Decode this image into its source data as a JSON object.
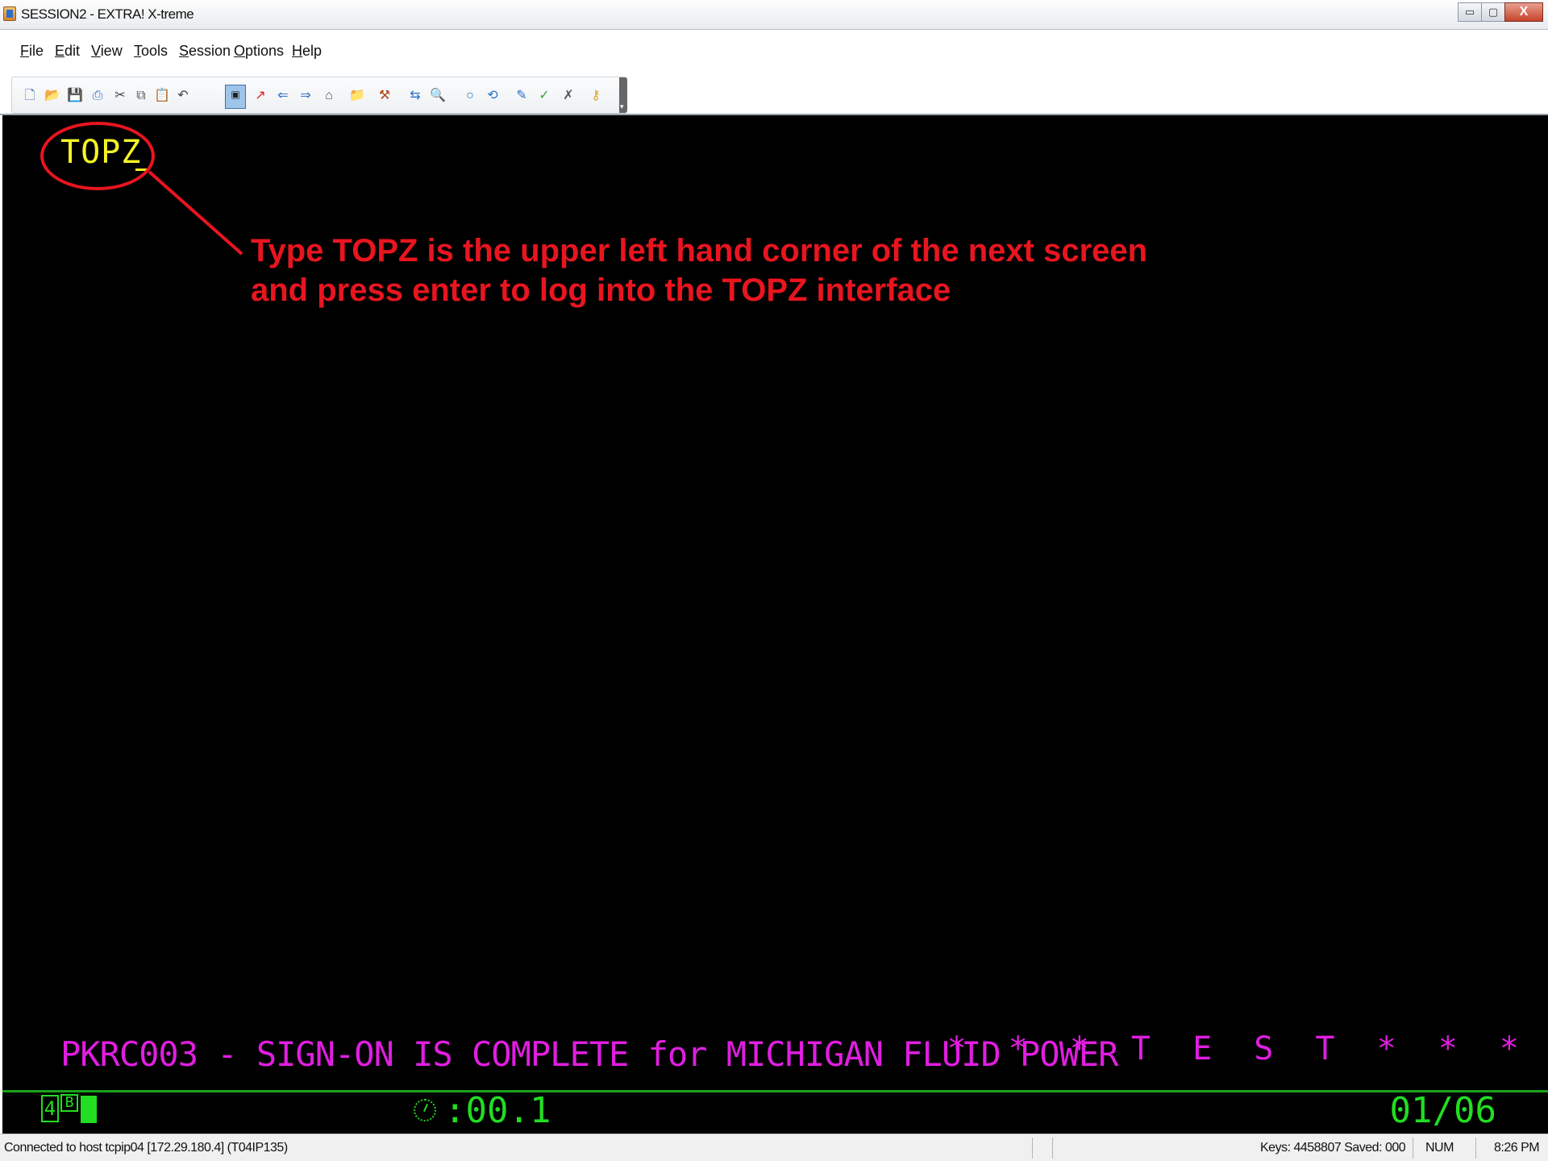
{
  "window": {
    "title": "SESSION2 - EXTRA! X-treme",
    "controls": {
      "minimize": "▭",
      "maximize": "▢",
      "close": "X"
    }
  },
  "menu": {
    "items": [
      {
        "label": "File",
        "key": "F",
        "rest": "ile"
      },
      {
        "label": "Edit",
        "key": "E",
        "rest": "dit"
      },
      {
        "label": "View",
        "key": "V",
        "rest": "iew"
      },
      {
        "label": "Tools",
        "key": "T",
        "rest": "ools"
      },
      {
        "label": "Session",
        "key": "S",
        "rest": "ession"
      },
      {
        "label": "Options",
        "key": "O",
        "rest": "ptions"
      },
      {
        "label": "Help",
        "key": "H",
        "rest": "elp"
      }
    ]
  },
  "toolbar": {
    "icons": [
      "new-icon",
      "open-icon",
      "save-icon",
      "print-icon",
      "cut-icon",
      "copy-icon",
      "paste-icon",
      "undo-icon",
      "display-toggle-icon",
      "connect-icon",
      "back-icon",
      "forward-icon",
      "home-icon",
      "folder-icon",
      "macro-icon",
      "file-transfer-icon",
      "find-icon",
      "circle-icon",
      "record-icon",
      "edit-macro-icon",
      "run-macro-icon",
      "stop-macro-icon",
      "help-key-icon"
    ]
  },
  "terminal": {
    "input_text": "TOPZ",
    "annotation": {
      "line1": "Type TOPZ is the upper left hand corner of the next screen",
      "line2": "and press enter to log into the TOPZ interface",
      "color": "#e8151f"
    },
    "message": "PKRC003 - SIGN-ON IS COMPLETE for MICHIGAN FLUID POWER",
    "test_banner": "* * * T E S T * * *",
    "oia": {
      "session_number": "4",
      "session_type": "B",
      "response_time": ":00.1",
      "cursor_position": "01/06"
    },
    "colors": {
      "background": "#000000",
      "input": "#f5f526",
      "message": "#e01ee0",
      "oia": "#22dd22"
    }
  },
  "statusbar": {
    "connection": "Connected to host tcpip04 [172.29.180.4] (T04IP135)",
    "keys": "Keys: 4458807  Saved: 000",
    "num": "NUM",
    "time": "8:26 PM"
  }
}
